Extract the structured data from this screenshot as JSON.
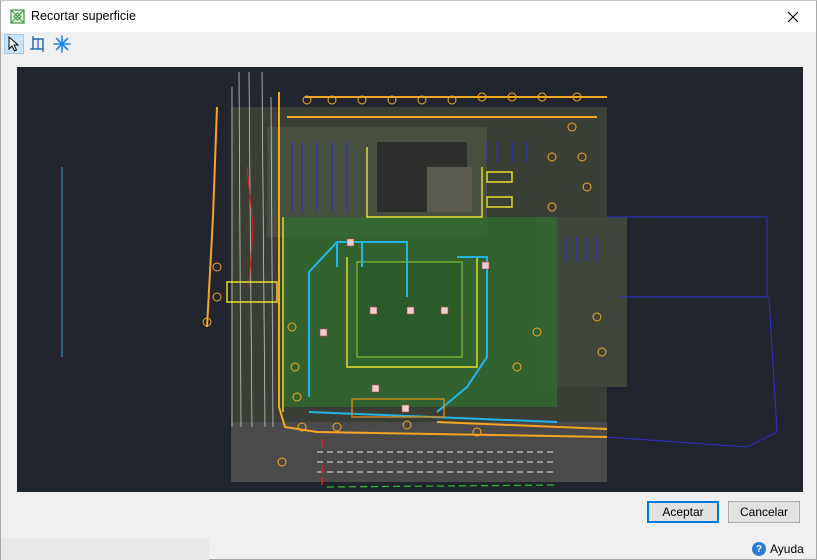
{
  "window": {
    "title": "Recortar superficie",
    "title_icon": "surface-crop-icon"
  },
  "toolbar": {
    "tools": [
      {
        "name": "select-arrow-icon",
        "active": true
      },
      {
        "name": "crop-rectangle-icon",
        "active": false
      },
      {
        "name": "snowflake-filter-icon",
        "active": false
      }
    ]
  },
  "viewport": {
    "background": "#21252e",
    "description_label": "CAD site plan preview"
  },
  "buttons": {
    "accept": "Aceptar",
    "cancel": "Cancelar"
  },
  "footer": {
    "help": "Ayuda"
  },
  "colors": {
    "accent": "#0078d7",
    "cad_orange": "#f5a623",
    "cad_cyan": "#22b6e6",
    "cad_green": "#2f8f2f",
    "cad_yellow": "#e8e02a",
    "cad_blue": "#3030c8"
  }
}
